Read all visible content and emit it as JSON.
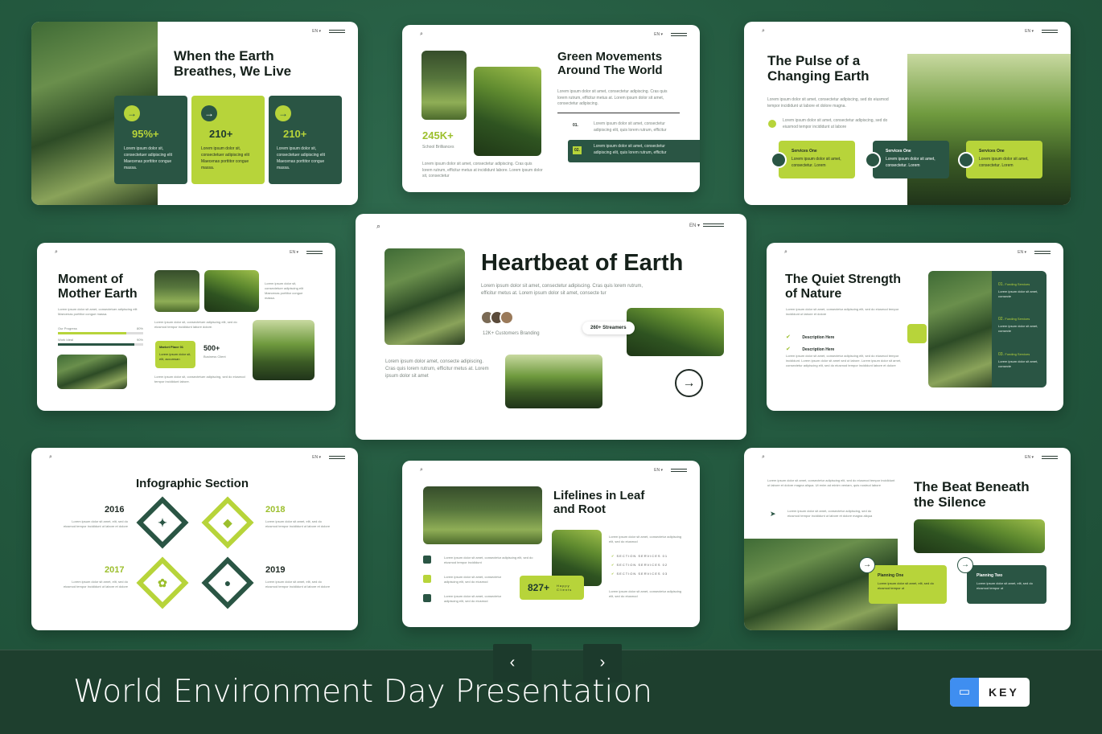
{
  "footer": {
    "title": "World Environment Day Presentation",
    "prev": "‹",
    "next": "›",
    "badge": "KEY",
    "badge_icon": "keynote-icon"
  },
  "common": {
    "lang": "EN ▾",
    "lorem": "Lorem ipsum dolor sit amet, consectetur adipiscing elit Maecenas porttitor congue massa."
  },
  "s1": {
    "title": "When the Earth Breathes, We Live",
    "stats": [
      {
        "value": "95%+",
        "text": "Lorem ipsum dolor sit, consectetuer adipiscing elit Maecenas porttitor congue massa."
      },
      {
        "value": "210+",
        "text": "Lorem ipsum dolor sit, consectetuer adipiscing elit Maecenas porttitor congue massa."
      },
      {
        "value": "210+",
        "text": "Lorem ipsum dolor sit, consectetuer adipiscing elit Maecenas porttitor congue massa."
      }
    ]
  },
  "s2": {
    "title": "Green Movements Around The World",
    "stat": "245K+",
    "stat_label": "School Brilliances",
    "desc": "Lorem ipsum dolor sit amet, consectetur adipiscing. Cras quis lorem rutrum, efficitur metus at. Lorem ipsum dolor sit amet, consectetur adipiscing.",
    "items": [
      {
        "num": "01.",
        "text": "Lorem ipsum dolor sit amet, consectetur adipiscing elit, quis lorem rutrum, efficitur"
      },
      {
        "num": "02.",
        "text": "Lorem ipsum dolor sit amet, consectetur adipiscing elit, quis lorem rutrum, efficitur"
      }
    ],
    "foot": "Lorem ipsum dolor sit amet, consectetur adipiscing. Cras quis lorem rutrum, efficitur metus at incididunt labore. Lorem ipsum dolor sit, consectetur"
  },
  "s3": {
    "title": "The Pulse of a Changing Earth",
    "desc": "Lorem ipsum dolor sit amet, consectetur adipiscing, sed do eiusmod tempor incididunt ut labore et dolore magna.",
    "note": "Lorem ipsum dolor sit amet, consectetur adipiscing, sed do eiusmod tempor incididunt ut labore",
    "services": [
      {
        "name": "Services One",
        "text": "Lorem ipsum dolor sit amet, consectetur. Lorem"
      },
      {
        "name": "Services One",
        "text": "Lorem ipsum dolor sit amet, consectetur. Lorem"
      },
      {
        "name": "Services One",
        "text": "Lorem ipsum dolor sit amet, consectetur. Lorem"
      }
    ]
  },
  "s4": {
    "title": "Moment of Mother Earth",
    "desc": "Lorem ipsum dolor sit amet, consectetuer adipiscing elit Maecenas porttitor congue massa.",
    "bars": [
      {
        "label": "Our Progress",
        "pct": "80%",
        "fill": 0.8
      },
      {
        "label": "Work Ideal",
        "pct": "90%",
        "fill": 0.9
      }
    ],
    "side": "Lorem ipsum dolor sit, consectetuer adipiscing elit Maecenas porttitor congue massa.",
    "mid": "Lorem ipsum dolor sit, consectetuer adipiscing elit, sed do eiusmod tempor incididunt labore dolore.",
    "market": "Market Place 01",
    "market_text": "Lorem ipsum dolor sit, elit, accumsan",
    "stat": "500+",
    "stat_label": "Business Client",
    "foot": "Lorem ipsum dolor sit, consectetuer adipiscing, sed do eiusmod tempor incididunt labore."
  },
  "s5": {
    "title": "Heartbeat of Earth",
    "desc": "Lorem ipsum dolor sit amet, consectetur adipiscing. Cras quis lorem rutrum, efficitur metus at. Lorem ipsum dolor sit amet, consecte tur",
    "customers": "12K+ Customers Branding",
    "streamers": "260+ Streamers",
    "left": "Lorem ipsum dolor amet, consecte adipiscing. Cras quis lorem rutrum, efficitur metus at. Lorem ipsum dolor sit amet"
  },
  "s6": {
    "title": "The Quiet Strength of Nature",
    "desc": "Lorem ipsum dolor sit amet, consectetur adipiscing elit, sed do eiusmod tempor incididunt ut labore et dolore",
    "checks": [
      "Description Here",
      "Description Here"
    ],
    "body": "Lorem ipsum dolor sit amet, consectetur adipiscing elit, sed do eiusmod tempor incididunt. Lorem ipsum dolor sit amet sed ut labore. Lorem ipsum dolor sit amet, consectetur adipiscing elit, sed do eiusmod tempor incididunt labore et dolore",
    "funding": [
      {
        "num": "01.",
        "name": "Funding Services",
        "text": "Lorem ipsum dolor sit amet, consecte"
      },
      {
        "num": "02.",
        "name": "Funding Services",
        "text": "Lorem ipsum dolor sit amet, consecte"
      },
      {
        "num": "03.",
        "name": "Funding Services",
        "text": "Lorem ipsum dolor sit amet, consecte"
      }
    ]
  },
  "s7": {
    "title": "Infographic Section",
    "years": [
      {
        "year": "2016",
        "text": "Lorem ipsum dolor sit amet, elit, sed do eiusmod tempor incididunt ut labore et dolore"
      },
      {
        "year": "2018",
        "text": "Lorem ipsum dolor sit amet, elit, sed do eiusmod tempor incididunt ut labore et dolore"
      },
      {
        "year": "2017",
        "text": "Lorem ipsum dolor sit amet, elit, sed do eiusmod tempor incididunt ut labore et dolore"
      },
      {
        "year": "2019",
        "text": "Lorem ipsum dolor sit amet, elit, sed do eiusmod tempor incididunt ut labore et dolore"
      }
    ]
  },
  "s8": {
    "title": "Lifelines in Leaf and Root",
    "rows": [
      "Lorem ipsum dolor sit amet, consectetur adipiscing elit, sed do eiusmod tempor incididunt",
      "Lorem ipsum dolor sit amet, consectetur adipiscing elit, sed do eiusmod",
      "Lorem ipsum dolor sit amet, consectetur adipiscing elit, sed do eiusmod"
    ],
    "right": "Lorem ipsum dolor sit amet, consectetur adipiscing elit, sed do eiusmod",
    "services": [
      "SECTION SERVICES 01",
      "SECTION SERVICES 02",
      "SECTION SERVICES 03"
    ],
    "right_foot": "Lorem ipsum dolor sit amet, consectetur adipiscing elit, sed do eiusmod",
    "stat": "827+",
    "stat_label": "Happy Clients"
  },
  "s9": {
    "title": "The Beat Beneath the Silence",
    "desc": "Lorem ipsum dolor sit amet, consectetur adipiscing elit, sed do eiusmod tempor incididunt ut labore et dolore magna aliqua. Ut enim ad minim veniam, quis nostrud labore",
    "note": "Lorem ipsum dolor sit amet, consectetur adipiscing, sed do eiusmod tempor incididunt ut labore et dolore magna aliqua",
    "plans": [
      {
        "name": "Planning One",
        "text": "Lorem ipsum dolor sit amet, elit, sed do eiusmod tempor ut"
      },
      {
        "name": "Planning Two",
        "text": "Lorem ipsum dolor sit amet, elit, sed do eiusmod tempor ut"
      }
    ]
  }
}
